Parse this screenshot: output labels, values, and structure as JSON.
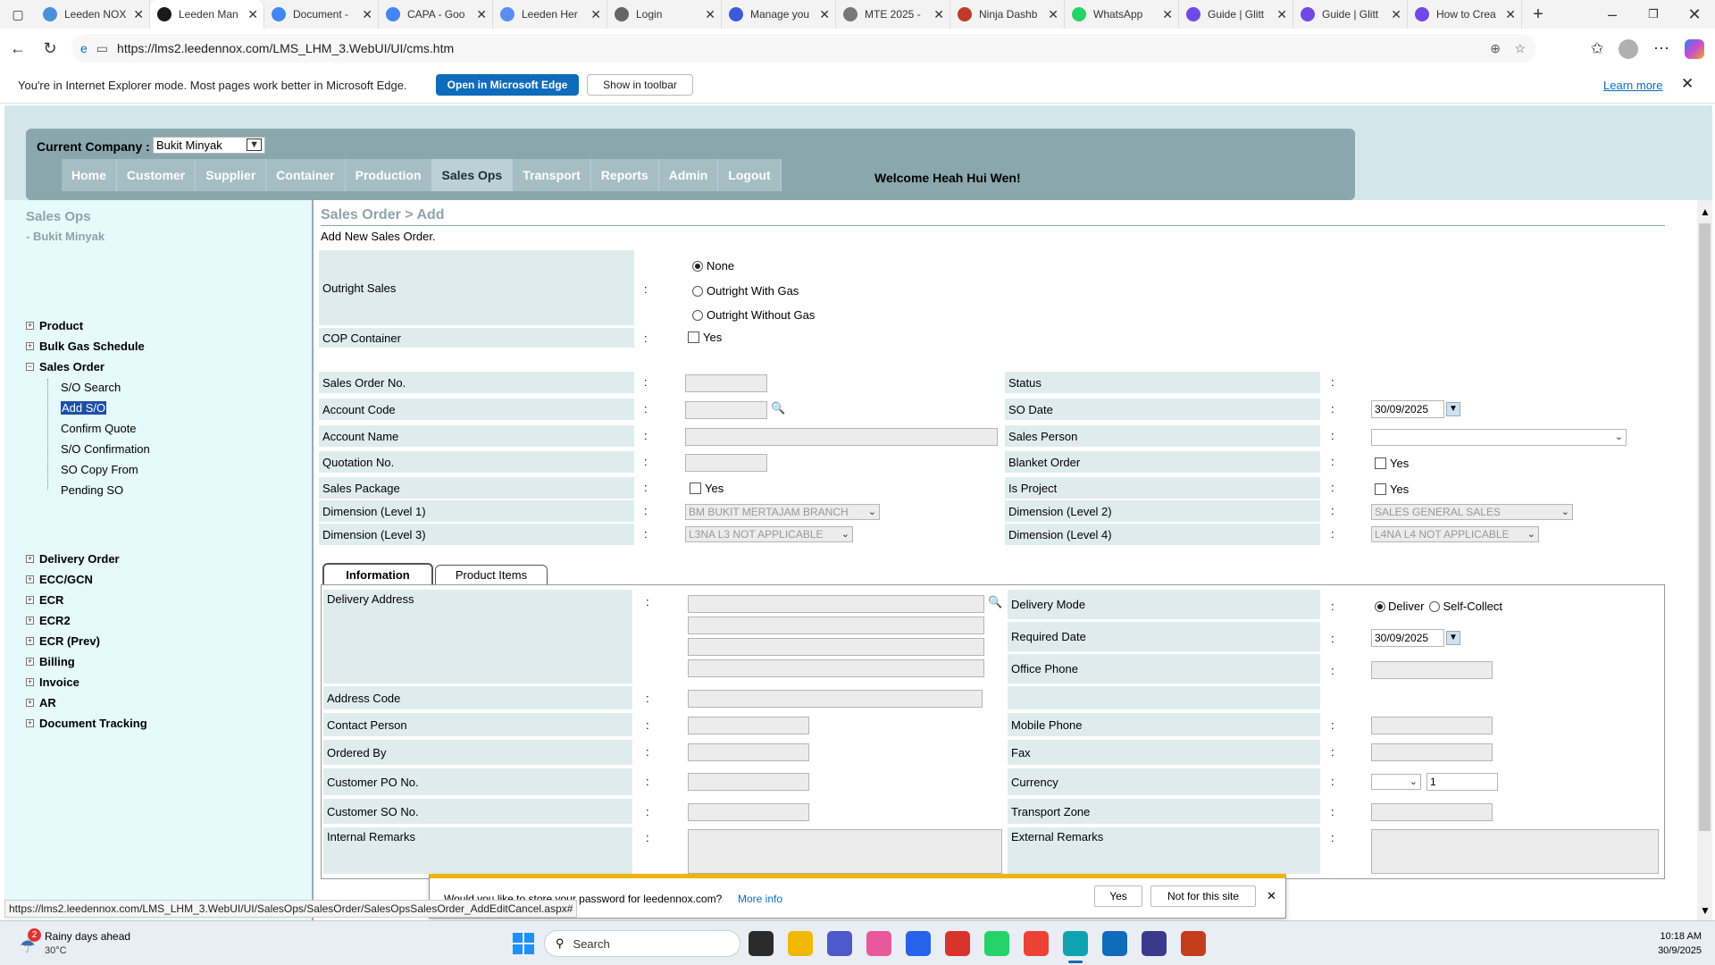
{
  "browser": {
    "tabs": [
      {
        "title": "Leeden NOX",
        "color": "#4a90d9"
      },
      {
        "title": "Leeden Man",
        "color": "#1a1a1a"
      },
      {
        "title": "Document -",
        "color": "#4285f4"
      },
      {
        "title": "CAPA - Goo",
        "color": "#4285f4"
      },
      {
        "title": "Leeden Her",
        "color": "#5b8def"
      },
      {
        "title": "Login",
        "color": "#666666"
      },
      {
        "title": "Manage you",
        "color": "#3b5bdb"
      },
      {
        "title": "MTE 2025 -",
        "color": "#777777"
      },
      {
        "title": "Ninja Dashb",
        "color": "#c0392b"
      },
      {
        "title": "WhatsApp",
        "color": "#25d366"
      },
      {
        "title": "Guide | Glitt",
        "color": "#7048e8"
      },
      {
        "title": "Guide | Glitt",
        "color": "#7048e8"
      },
      {
        "title": "How to Crea",
        "color": "#7048e8"
      }
    ],
    "url": "https://lms2.leedennox.com/LMS_LHM_3.WebUI/UI/cms.htm",
    "ie_message": "You're in Internet Explorer mode. Most pages work better in Microsoft Edge.",
    "open_edge": "Open in Microsoft Edge",
    "show_toolbar": "Show in toolbar",
    "learn_more": "Learn more",
    "status_url": "https://lms2.leedennox.com/LMS_LHM_3.WebUI/UI/SalesOps/SalesOrder/SalesOpsSalesOrder_AddEditCancel.aspx#"
  },
  "header": {
    "company_label": "Current Company :",
    "company_value": "Bukit Minyak",
    "welcome": "Welcome Heah Hui Wen!",
    "nav": [
      "Home",
      "Customer",
      "Supplier",
      "Container",
      "Production",
      "Sales Ops",
      "Transport",
      "Reports",
      "Admin",
      "Logout"
    ],
    "active_nav": "Sales Ops"
  },
  "sidebar": {
    "title": "Sales Ops",
    "subtitle": "- Bukit Minyak",
    "items": [
      "Product",
      "Bulk Gas Schedule",
      "Sales Order",
      "Delivery Order",
      "ECC/GCN",
      "ECR",
      "ECR2",
      "ECR (Prev)",
      "Billing",
      "Invoice",
      "AR",
      "Document Tracking"
    ],
    "sales_order_children": [
      "S/O Search",
      "Add S/O",
      "Confirm Quote",
      "S/O Confirmation",
      "SO Copy From",
      "Pending SO"
    ]
  },
  "form": {
    "breadcrumb": "Sales Order > Add",
    "description": "Add New Sales Order.",
    "colon": ":",
    "outright_label": "Outright Sales",
    "outright_options": [
      "None",
      "Outright With Gas",
      "Outright Without Gas"
    ],
    "cop_label": "COP Container",
    "yes": "Yes",
    "so_no": "Sales Order No.",
    "account_code": "Account Code",
    "account_name": "Account Name",
    "quotation_no": "Quotation No.",
    "sales_package": "Sales Package",
    "dim1": "Dimension (Level 1)",
    "dim1_value": "BM BUKIT MERTAJAM BRANCH",
    "dim3": "Dimension (Level 3)",
    "dim3_value": "L3NA L3 NOT APPLICABLE",
    "status": "Status",
    "so_date": "SO Date",
    "so_date_value": "30/09/2025",
    "sales_person": "Sales Person",
    "blanket_order": "Blanket Order",
    "is_project": "Is Project",
    "dim2": "Dimension (Level 2)",
    "dim2_value": "SALES GENERAL SALES",
    "dim4": "Dimension (Level 4)",
    "dim4_value": "L4NA L4 NOT APPLICABLE"
  },
  "tabs": {
    "information": "Information",
    "product_items": "Product Items"
  },
  "info": {
    "delivery_address": "Delivery Address",
    "address_code": "Address Code",
    "contact_person": "Contact Person",
    "ordered_by": "Ordered By",
    "customer_po": "Customer PO No.",
    "customer_so": "Customer SO No.",
    "internal_remarks": "Internal Remarks",
    "delivery_mode": "Delivery Mode",
    "deliver": "Deliver",
    "self_collect": "Self-Collect",
    "required_date": "Required Date",
    "required_date_value": "30/09/2025",
    "office_phone": "Office Phone",
    "mobile_phone": "Mobile Phone",
    "fax": "Fax",
    "currency": "Currency",
    "currency_rate": "1",
    "transport_zone": "Transport Zone",
    "external_remarks": "External Remarks"
  },
  "password_prompt": {
    "message": "Would you like to store your password for leedennox.com?",
    "more_info": "More info",
    "yes": "Yes",
    "no": "Not for this site"
  },
  "taskbar": {
    "weather_title": "Rainy days ahead",
    "weather_temp": "30°C",
    "weather_badge": "2",
    "search": "Search",
    "time": "10:18 AM",
    "date": "30/9/2025"
  }
}
